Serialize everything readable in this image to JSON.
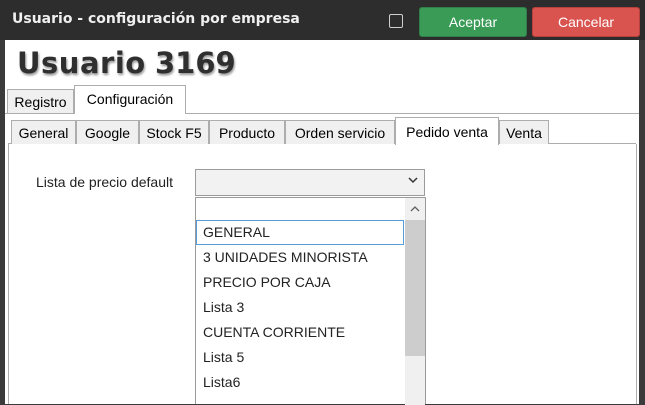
{
  "window": {
    "title": "Usuario - configuración por empresa",
    "accept_label": "Aceptar",
    "cancel_label": "Cancelar"
  },
  "header": {
    "title": "Usuario",
    "number": "3169"
  },
  "outer_tabs": [
    {
      "label": "Registro",
      "active": false
    },
    {
      "label": "Configuración",
      "active": true
    }
  ],
  "inner_tabs": [
    {
      "label": "General",
      "active": false
    },
    {
      "label": "Google",
      "active": false
    },
    {
      "label": "Stock F5",
      "active": false
    },
    {
      "label": "Producto",
      "active": false
    },
    {
      "label": "Orden servicio",
      "active": false
    },
    {
      "label": "Pedido venta",
      "active": true
    },
    {
      "label": "Venta",
      "active": false
    }
  ],
  "form": {
    "price_list_label": "Lista de precio default",
    "price_list_value": ""
  },
  "dropdown": {
    "options": [
      "GENERAL",
      "3 UNIDADES MINORISTA",
      "PRECIO POR CAJA",
      "Lista 3",
      "CUENTA CORRIENTE",
      "Lista 5",
      "Lista6"
    ],
    "highlighted": "GENERAL"
  },
  "colors": {
    "accept": "#3a9b57",
    "cancel": "#d9534f",
    "titlebar": "#2d2d2d",
    "selection_border": "#5b9bd5"
  }
}
